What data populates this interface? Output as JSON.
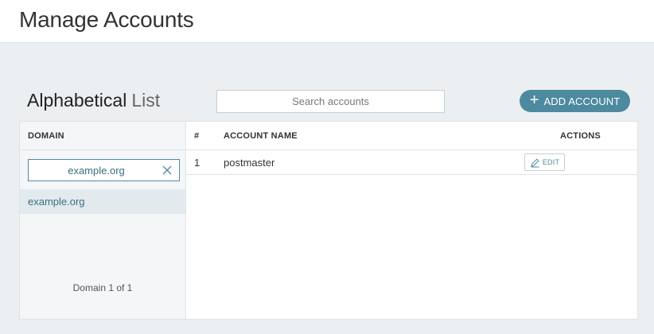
{
  "header": {
    "title": "Manage Accounts"
  },
  "list": {
    "title_strong": "Alphabetical",
    "title_light": "List",
    "search_placeholder": "Search accounts",
    "add_button_label": "ADD ACCOUNT"
  },
  "domains": {
    "column_header": "DOMAIN",
    "filter_value": "example.org",
    "items": [
      {
        "label": "example.org"
      }
    ],
    "pager": "Domain 1 of 1"
  },
  "accounts": {
    "columns": {
      "num": "#",
      "name": "ACCOUNT NAME",
      "actions": "ACTIONS"
    },
    "rows": [
      {
        "num": "1",
        "name": "postmaster",
        "edit_label": "EDIT"
      }
    ]
  },
  "colors": {
    "accent": "#4e8a9f",
    "link": "#3a6f82",
    "background": "#eceff1"
  },
  "icons": {
    "add": "plus-icon",
    "clear": "close-icon",
    "edit": "pencil-icon"
  }
}
